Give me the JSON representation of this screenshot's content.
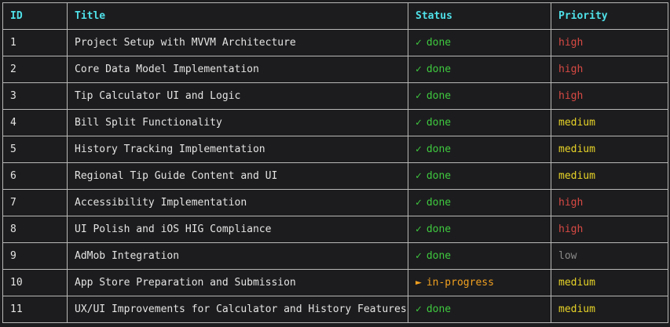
{
  "colors": {
    "background": "#1c1c1e",
    "border": "#b8b8b8",
    "header": "#4fe0e8",
    "done": "#3fc93f",
    "in_progress": "#f0a020",
    "high": "#d84a44",
    "medium": "#e8d428",
    "low": "#8a8a8a"
  },
  "table": {
    "headers": {
      "id": "ID",
      "title": "Title",
      "status": "Status",
      "priority": "Priority"
    },
    "rows": [
      {
        "id": "1",
        "title": "Project Setup with MVVM Architecture",
        "status_glyph": "✓",
        "status": "done",
        "status_kind": "done",
        "priority": "high"
      },
      {
        "id": "2",
        "title": "Core Data Model Implementation",
        "status_glyph": "✓",
        "status": "done",
        "status_kind": "done",
        "priority": "high"
      },
      {
        "id": "3",
        "title": "Tip Calculator UI and Logic",
        "status_glyph": "✓",
        "status": "done",
        "status_kind": "done",
        "priority": "high"
      },
      {
        "id": "4",
        "title": "Bill Split Functionality",
        "status_glyph": "✓",
        "status": "done",
        "status_kind": "done",
        "priority": "medium"
      },
      {
        "id": "5",
        "title": "History Tracking Implementation",
        "status_glyph": "✓",
        "status": "done",
        "status_kind": "done",
        "priority": "medium"
      },
      {
        "id": "6",
        "title": "Regional Tip Guide Content and UI",
        "status_glyph": "✓",
        "status": "done",
        "status_kind": "done",
        "priority": "medium"
      },
      {
        "id": "7",
        "title": "Accessibility Implementation",
        "status_glyph": "✓",
        "status": "done",
        "status_kind": "done",
        "priority": "high"
      },
      {
        "id": "8",
        "title": "UI Polish and iOS HIG Compliance",
        "status_glyph": "✓",
        "status": "done",
        "status_kind": "done",
        "priority": "high"
      },
      {
        "id": "9",
        "title": "AdMob Integration",
        "status_glyph": "✓",
        "status": "done",
        "status_kind": "done",
        "priority": "low"
      },
      {
        "id": "10",
        "title": "App Store Preparation and Submission",
        "status_glyph": "►",
        "status": "in-progress",
        "status_kind": "progress",
        "priority": "medium"
      },
      {
        "id": "11",
        "title": "UX/UI Improvements for Calculator and History Features",
        "status_glyph": "✓",
        "status": "done",
        "status_kind": "done",
        "priority": "medium"
      }
    ]
  }
}
